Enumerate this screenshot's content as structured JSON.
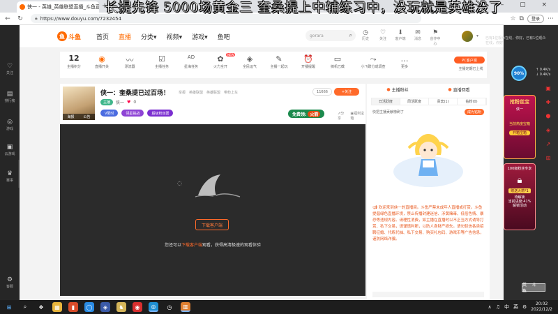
{
  "browser": {
    "tab_title": "侠一 - 英雄_英雄联盟直播_斗鱼直播",
    "tab_close": "×",
    "new_tab": "+",
    "url": "https://www.douyu.com/7232454",
    "login_label": "登录",
    "window_controls": "– ▢ ×"
  },
  "overlay_marquee": "长提先锋 5000场黄金三 奎桑提上中辅练习中，没玩就是英雄没了",
  "left_sidebar": [
    {
      "icon": "♡",
      "label": "关注"
    },
    {
      "icon": "▤",
      "label": "排行榜"
    },
    {
      "icon": "◎",
      "label": "游戏"
    },
    {
      "icon": "▣",
      "label": "云游戏"
    },
    {
      "icon": "♛",
      "label": "赛事"
    },
    {
      "icon": "⚙",
      "label": "客服"
    }
  ],
  "header": {
    "logo_text": "斗鱼",
    "nav": [
      "首页",
      "直播",
      "分类▾",
      "视频▾",
      "游戏▾",
      "鱼吧"
    ],
    "search_placeholder": "gorara",
    "icons": [
      {
        "icon": "◷",
        "label": "历史"
      },
      {
        "icon": "♡",
        "label": "关注"
      },
      {
        "icon": "⬇",
        "label": "客户端"
      },
      {
        "icon": "✉",
        "label": "消息"
      },
      {
        "icon": "⚑",
        "label": "创作中心"
      }
    ]
  },
  "toolbar": {
    "count": "12",
    "count_label": "主播积分",
    "items": [
      {
        "icon": "◉",
        "label": "直播开关"
      },
      {
        "icon": "〰",
        "label": "漂流器"
      },
      {
        "icon": "☑",
        "label": "主播任务"
      },
      {
        "icon": "AD",
        "label": "星海任务"
      },
      {
        "icon": "✿",
        "label": "火力全开"
      },
      {
        "icon": "◈",
        "label": "全民运气"
      },
      {
        "icon": "✎",
        "label": "主播一起玩"
      },
      {
        "icon": "⏰",
        "label": "开播提醒"
      },
      {
        "icon": "▭",
        "label": "搞机已截"
      },
      {
        "icon": "⤳",
        "label": "小飞碟分成调查"
      },
      {
        "icon": "…",
        "label": "更多"
      }
    ],
    "new_badge": "NEW",
    "pc_button": "PC客户端",
    "pc_sub": "主播定期已上线"
  },
  "room": {
    "title": "侠一：奎桑提已过百场！",
    "tags": [
      "举报",
      "英雄联盟",
      "英雄联盟",
      "带粉上车"
    ],
    "follow_count": "11666",
    "follow_label": "关注",
    "host_name": "侠一",
    "host_chip": "主播",
    "likes": "0",
    "pills": [
      "V限时",
      "领星挑战",
      "超级粉丝团"
    ],
    "thumb_labels": [
      "海报",
      "公告"
    ],
    "free_badge": "免费领:",
    "free_badge_fire": "火箭",
    "tools": [
      "分享",
      "福利宝箱"
    ]
  },
  "video": {
    "download_btn": "下载客户端",
    "tip_pre": "您还可以",
    "tip_highlight": "下载客户端",
    "tip_post": "观看，获得高清极速的观看体验"
  },
  "rpanel": {
    "tab1": "主播粉丝",
    "tab2": "直播回看",
    "tabs2": [
      "日活跃度",
      "周活跃度",
      "贵宾(1)",
      "钻粉(0)"
    ],
    "rank_hint": "快把主播贡献榜刷了",
    "rank_btn": "成为钻粉",
    "chat_text": "欢迎来到侠一的直播间。斗鱼严禁未成年人直播或打赏。斗鱼提倡绿色直播环境，禁止传播封建迷信、涉黄赌毒、低俗色情、暴恐等违规内容。请理性消费，如主播在直播时以不正当方式诱导打赏、私下交易，请谨慎判断，以防人身财产损失。请勿轻信各类招聘征婚、代练代抽、私下交易、购买礼包码、游戏币等广告信息，谨防网络诈骗。"
  },
  "right_widgets": {
    "note": "已有1位观众在线，你好，已有1位观众在线，你好",
    "speed": "90%",
    "speed_info": "↑ 0.4K/s\n↓ 0.4K/s",
    "box1_title": "抢粉丝宝",
    "box1_sub": "侠一",
    "box1_yellow": "当前热度宝箱",
    "box1_btn": "开箱宝箱",
    "box2_title": "100级粉丝专享",
    "box2_gift": "赠送火箭*1",
    "box2_sub": "待解锁\n当前进度:41%\n解锁活动",
    "stamp": "英 斗 鱼"
  },
  "taskbar": {
    "apps": [
      "⊞",
      "⌕",
      "❖",
      "▦",
      "▮",
      "◯",
      "◈",
      "♞",
      "◉",
      "◎",
      "◷",
      "▥"
    ],
    "tray": [
      "∧",
      "♫",
      "中",
      "英",
      "⚙"
    ],
    "time": "20:02",
    "date": "2022/12/2"
  },
  "colors": {
    "accent": "#ff6a00",
    "chat_text": "#e8581d",
    "video_bg": "#2b2b2b"
  }
}
